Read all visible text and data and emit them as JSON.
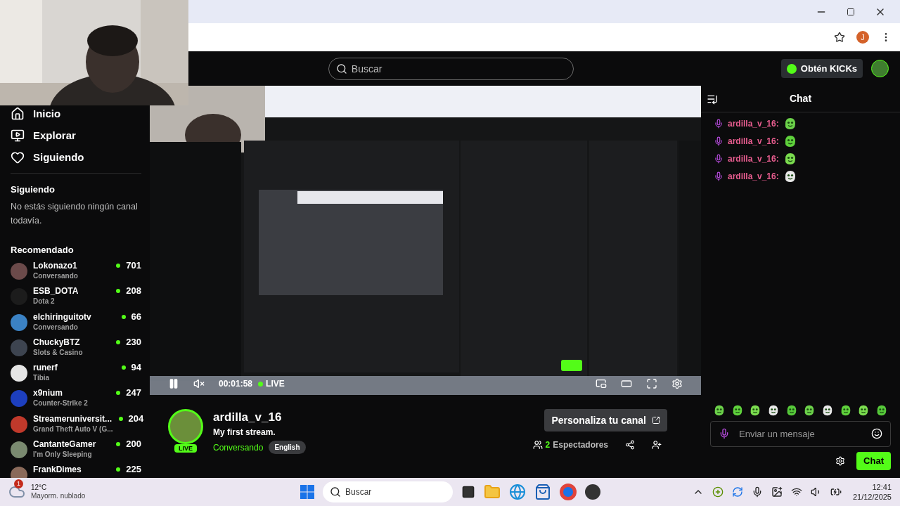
{
  "browser": {
    "profile_initial": "J"
  },
  "header": {
    "search": {
      "placeholder": "Buscar"
    },
    "kicks_button": "Obtén KICKs"
  },
  "sidebar": {
    "nav": [
      {
        "kind": "home",
        "label": "Inicio"
      },
      {
        "kind": "explore",
        "label": "Explorar"
      },
      {
        "kind": "following",
        "label": "Siguiendo"
      }
    ],
    "following_title": "Siguiendo",
    "following_empty": "No estás siguiendo ningún canal todavía.",
    "recommended_title": "Recomendado",
    "channels": [
      {
        "name": "Lokonazo1",
        "category": "Conversando",
        "viewers": "701"
      },
      {
        "name": "ESB_DOTA",
        "category": "Dota 2",
        "viewers": "208"
      },
      {
        "name": "elchiringuitotv",
        "category": "Conversando",
        "viewers": "66"
      },
      {
        "name": "ChuckyBTZ",
        "category": "Slots & Casino",
        "viewers": "230"
      },
      {
        "name": "runerf",
        "category": "Tibia",
        "viewers": "94"
      },
      {
        "name": "x9nium",
        "category": "Counter-Strike 2",
        "viewers": "247"
      },
      {
        "name": "Streameruniversit...",
        "category": "Grand Theft Auto V (G...",
        "viewers": "204"
      },
      {
        "name": "CantanteGamer",
        "category": "I'm Only Sleeping",
        "viewers": "200"
      },
      {
        "name": "FrankDimes",
        "viewers": "225"
      }
    ]
  },
  "player": {
    "muted": true,
    "time": "00:01:58",
    "live": "LIVE"
  },
  "stream": {
    "channel": "ardilla_v_16",
    "live_badge": "LIVE",
    "title": "My first stream.",
    "category": "Conversando",
    "tags": [
      "English"
    ],
    "customize_button": "Personaliza tu canal",
    "viewers": "2",
    "viewers_label": "Espectadores"
  },
  "chat": {
    "title": "Chat",
    "messages": [
      {
        "user": "ardilla_v_16:"
      },
      {
        "user": "ardilla_v_16:"
      },
      {
        "user": "ardilla_v_16:"
      },
      {
        "user": "ardilla_v_16:"
      }
    ],
    "input": {
      "placeholder": "Enviar un mensaje"
    },
    "send_button": "Chat"
  },
  "taskbar": {
    "weather": {
      "badge": "1",
      "temp": "12°C",
      "desc": "Mayorm. nublado"
    },
    "search": {
      "placeholder": "Buscar"
    },
    "time": "12:41",
    "date": "21/12/2025"
  }
}
